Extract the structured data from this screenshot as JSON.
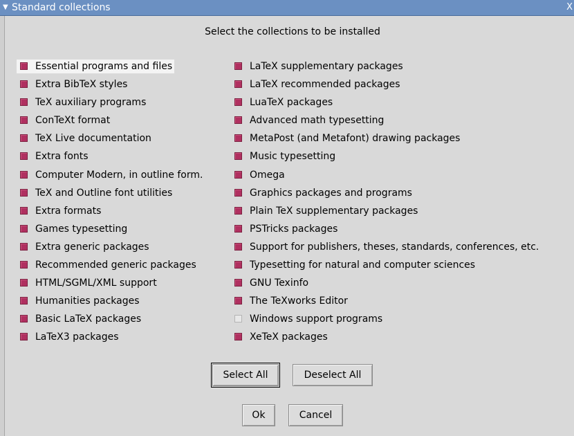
{
  "window": {
    "title": "Standard collections",
    "collapse_glyph": "▼",
    "close_glyph": "X"
  },
  "heading": "Select the collections to be installed",
  "left_column": [
    {
      "label": "Essential programs and files",
      "checked": true
    },
    {
      "label": "Extra BibTeX styles",
      "checked": true
    },
    {
      "label": "TeX auxiliary programs",
      "checked": true
    },
    {
      "label": "ConTeXt format",
      "checked": true
    },
    {
      "label": "TeX Live documentation",
      "checked": true
    },
    {
      "label": "Extra fonts",
      "checked": true
    },
    {
      "label": "Computer Modern, in outline form.",
      "checked": true
    },
    {
      "label": "TeX and Outline font utilities",
      "checked": true
    },
    {
      "label": "Extra formats",
      "checked": true
    },
    {
      "label": "Games typesetting",
      "checked": true
    },
    {
      "label": "Extra generic packages",
      "checked": true
    },
    {
      "label": "Recommended generic packages",
      "checked": true
    },
    {
      "label": "HTML/SGML/XML support",
      "checked": true
    },
    {
      "label": "Humanities packages",
      "checked": true
    },
    {
      "label": "Basic LaTeX packages",
      "checked": true
    },
    {
      "label": "LaTeX3 packages",
      "checked": true
    }
  ],
  "right_column": [
    {
      "label": "LaTeX supplementary packages",
      "checked": true
    },
    {
      "label": "LaTeX recommended packages",
      "checked": true
    },
    {
      "label": "LuaTeX packages",
      "checked": true
    },
    {
      "label": "Advanced math typesetting",
      "checked": true
    },
    {
      "label": "MetaPost (and Metafont) drawing packages",
      "checked": true
    },
    {
      "label": "Music typesetting",
      "checked": true
    },
    {
      "label": "Omega",
      "checked": true
    },
    {
      "label": "Graphics packages and programs",
      "checked": true
    },
    {
      "label": "Plain TeX supplementary packages",
      "checked": true
    },
    {
      "label": "PSTricks packages",
      "checked": true
    },
    {
      "label": "Support for publishers, theses, standards, conferences, etc.",
      "checked": true
    },
    {
      "label": "Typesetting for natural and computer sciences",
      "checked": true
    },
    {
      "label": "GNU Texinfo",
      "checked": true
    },
    {
      "label": "The TeXworks Editor",
      "checked": true
    },
    {
      "label": "Windows support programs",
      "checked": false
    },
    {
      "label": "XeTeX packages",
      "checked": true
    }
  ],
  "buttons": {
    "select_all": "Select All",
    "deselect_all": "Deselect All",
    "ok": "Ok",
    "cancel": "Cancel"
  },
  "colors": {
    "title_bar": "#6b90c2",
    "checked": "#b03060",
    "unchecked": "#e8e8e8",
    "background": "#d9d9d9"
  }
}
